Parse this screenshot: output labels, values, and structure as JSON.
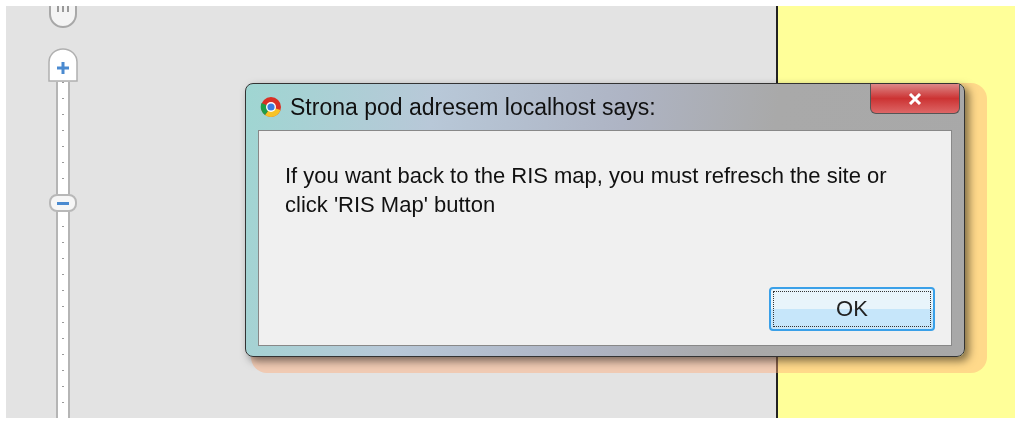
{
  "dialog": {
    "title": "Strona pod adresem localhost says:",
    "message": "If you want back to the RIS map, you must refresch the site or click 'RIS Map' button",
    "buttons": [
      {
        "label": "OK",
        "selected": true
      }
    ]
  }
}
